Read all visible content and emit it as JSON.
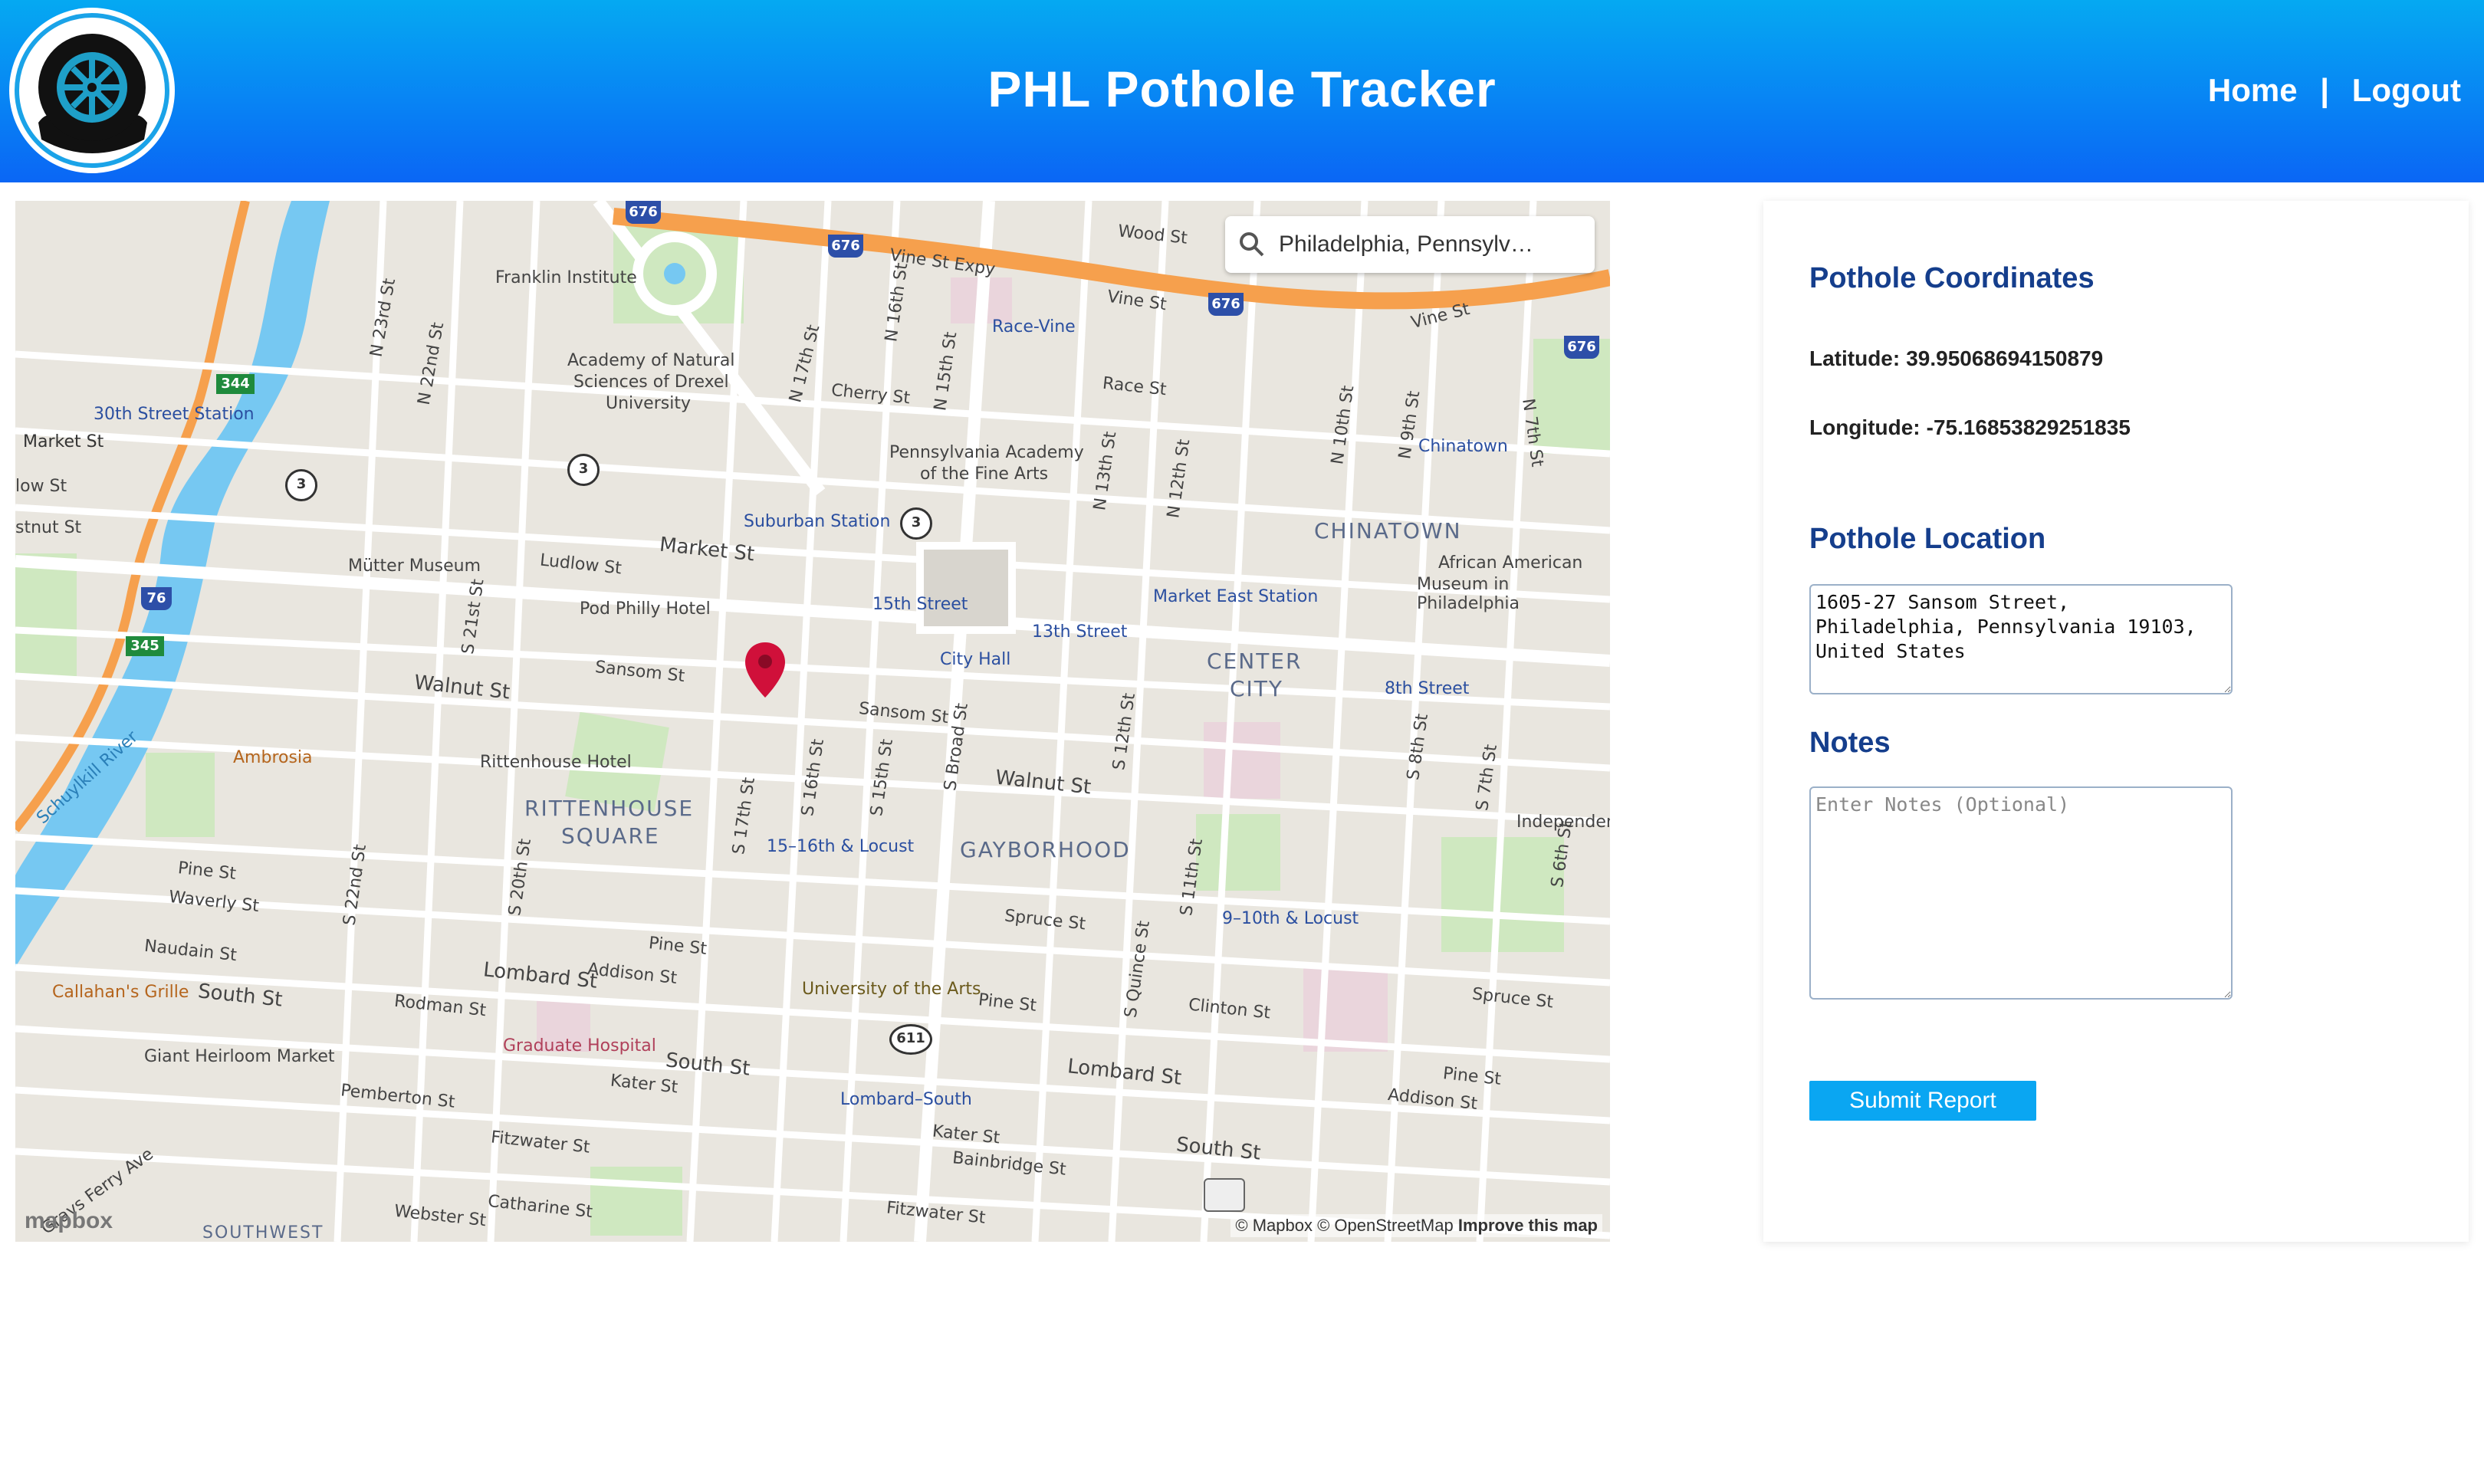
{
  "app": {
    "title": "PHL Pothole Tracker"
  },
  "nav": {
    "home": "Home",
    "separator": "|",
    "logout": "Logout"
  },
  "map": {
    "search_text": "Philadelphia, Pennsylv…",
    "attribution": "© Mapbox © OpenStreetMap",
    "improve_link": "Improve this map",
    "provider_logo": "mapbox",
    "labels": {
      "franklin": "Franklin Institute",
      "academy1": "Academy of Natural",
      "academy2": "Sciences of Drexel",
      "academy3": "University",
      "station30": "30th Street Station",
      "market_w": "Market St",
      "raceVine": "Race-Vine",
      "vineExpy": "Vine St Expy",
      "vine1": "Vine St",
      "vine2": "Vine St",
      "wood": "Wood St",
      "race": "Race St",
      "cherry": "Cherry St",
      "pafa1": "Pennsylvania Academy",
      "pafa2": "of the Fine Arts",
      "suburban": "Suburban Station",
      "chinatown_st": "Chinatown",
      "chinatown": "CHINATOWN",
      "aam1": "African American",
      "aam2": "Museum in Philadelphia",
      "mutter": "Mütter Museum",
      "ludlow": "Ludlow St",
      "market": "Market St",
      "podphilly": "Pod Philly Hotel",
      "st15": "15th Street",
      "st13": "13th Street",
      "marketEast": "Market East Station",
      "cityhall": "City Hall",
      "sansom1": "Sansom St",
      "sansom2": "Sansom St",
      "walnut1": "Walnut St",
      "walnut2": "Walnut St",
      "centercity1": "CENTER",
      "centercity2": "CITY",
      "st8": "8th Street",
      "ambrosia": "Ambrosia",
      "rittenhouseHotel": "Rittenhouse Hotel",
      "rittenhouse1": "RITTENHOUSE",
      "rittenhouse2": "SQUARE",
      "locust1516": "15–16th & Locust",
      "gayborhood": "GAYBORHOOD",
      "locust910": "9–10th & Locust",
      "independence": "Independen",
      "pine1": "Pine St",
      "waverly": "Waverly St",
      "naudain": "Naudain St",
      "spruce1": "Spruce St",
      "spruce2": "Spruce St",
      "pine2": "Pine St",
      "pine3": "Pine St",
      "pine4": "Pine St",
      "callahan": "Callahan's Grille",
      "southSt1": "South St",
      "lombard1": "Lombard St",
      "addison1": "Addison St",
      "rodman": "Rodman St",
      "uarts": "University of the Arts",
      "clinton": "Clinton St",
      "giant": "Giant Heirloom Market",
      "gradHosp": "Graduate Hospital",
      "southSt2": "South St",
      "kater1": "Kater St",
      "lombardSouth": "Lombard–South",
      "lombard2": "Lombard St",
      "addison2": "Addison St",
      "pemberton": "Pemberton St",
      "fitzwater1": "Fitzwater St",
      "kater2": "Kater St",
      "bainbridge": "Bainbridge St",
      "southSt3": "South St",
      "webster": "Webster St",
      "catharine": "Catharine St",
      "fitzwater2": "Fitzwater St",
      "grays": "Grays Ferry Ave",
      "schuylkill": "Schuylkill River",
      "southwest": "SOUTHWEST",
      "n23": "N 23rd St",
      "n22": "N 22nd St",
      "n17": "N 17th St",
      "n16": "N 16th St",
      "n15": "N 15th St",
      "n13": "N 13th St",
      "n12": "N 12th St",
      "n10": "N 10th St",
      "n9": "N 9th St",
      "n7": "N 7th St",
      "s21": "S 21st St",
      "s20": "S 20th St",
      "s22": "S 22nd St",
      "s17": "S 17th St",
      "s16": "S 16th St",
      "s15": "S 15th St",
      "sbroad": "S Broad St",
      "s12": "S 12th St",
      "s11": "S 11th St",
      "squince": "S Quince St",
      "s8": "S 8th St",
      "s7": "S 7th St",
      "s6": "S 6th St",
      "lowSt": "low St",
      "stnutSt": "stnut St",
      "shield676a": "676",
      "shield676b": "676",
      "shield676c": "676",
      "shield676d": "676",
      "shield76": "76",
      "shield344": "344",
      "shield345": "345",
      "shield3a": "3",
      "shield3b": "3",
      "shield3c": "3",
      "shield611": "611"
    }
  },
  "panel": {
    "coords_heading": "Pothole Coordinates",
    "latitude_label": "Latitude:",
    "latitude_value": "39.95068694150879",
    "longitude_label": "Longitude:",
    "longitude_value": "-75.16853829251835",
    "location_heading": "Pothole Location",
    "location_value": "1605-27 Sansom Street, Philadelphia, Pennsylvania 19103, United States",
    "notes_heading": "Notes",
    "notes_placeholder": "Enter Notes (Optional)",
    "notes_value": "",
    "submit_label": "Submit Report"
  },
  "colors": {
    "header_top": "#05a9f2",
    "header_bottom": "#0a66f5",
    "heading": "#153e8c",
    "submit": "#0aa6f2",
    "pin": "#d0103a"
  },
  "icons": {
    "logo": "tire-logo-icon",
    "search": "search-icon",
    "pin": "location-pin-icon"
  }
}
